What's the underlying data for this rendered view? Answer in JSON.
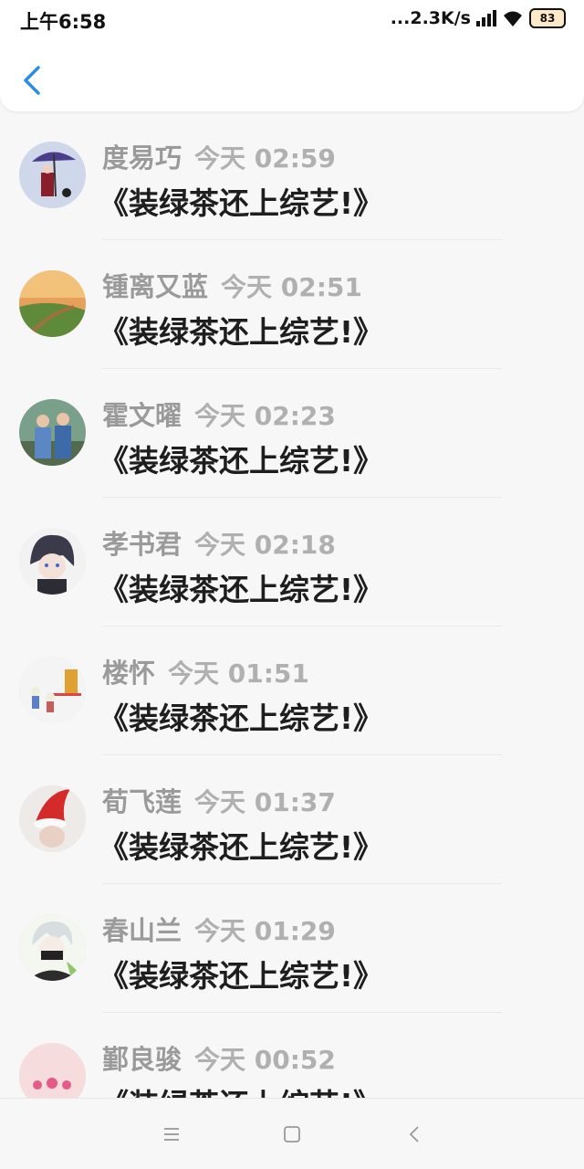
{
  "status_bar": {
    "time": "上午6:58",
    "network_speed": "...2.3K/s",
    "battery_level": "83",
    "icons": [
      "signal-icon",
      "wifi-icon",
      "battery-icon"
    ]
  },
  "header": {
    "back_icon": "chevron-left-icon"
  },
  "items": [
    {
      "name": "度易巧",
      "time": "今天 02:59",
      "title": "《装绿茶还上综艺!》"
    },
    {
      "name": "锺离又蓝",
      "time": "今天 02:51",
      "title": "《装绿茶还上综艺!》"
    },
    {
      "name": "霍文曜",
      "time": "今天 02:23",
      "title": "《装绿茶还上综艺!》"
    },
    {
      "name": "孝书君",
      "time": "今天 02:18",
      "title": "《装绿茶还上综艺!》"
    },
    {
      "name": "楼怀",
      "time": "今天 01:51",
      "title": "《装绿茶还上综艺!》"
    },
    {
      "name": "荀飞莲",
      "time": "今天 01:37",
      "title": "《装绿茶还上综艺!》"
    },
    {
      "name": "春山兰",
      "time": "今天 01:29",
      "title": "《装绿茶还上综艺!》"
    },
    {
      "name": "鄞良骏",
      "time": "今天 00:52",
      "title": "《装绿茶还上综艺!》"
    }
  ],
  "nav_bar": {
    "icons": [
      "menu-icon",
      "home-icon",
      "back-icon"
    ]
  },
  "colors": {
    "accent": "#2b8de8",
    "name_gray": "#9a9a9a",
    "title_dark": "#1e1e1e",
    "background": "#f7f7f7"
  }
}
